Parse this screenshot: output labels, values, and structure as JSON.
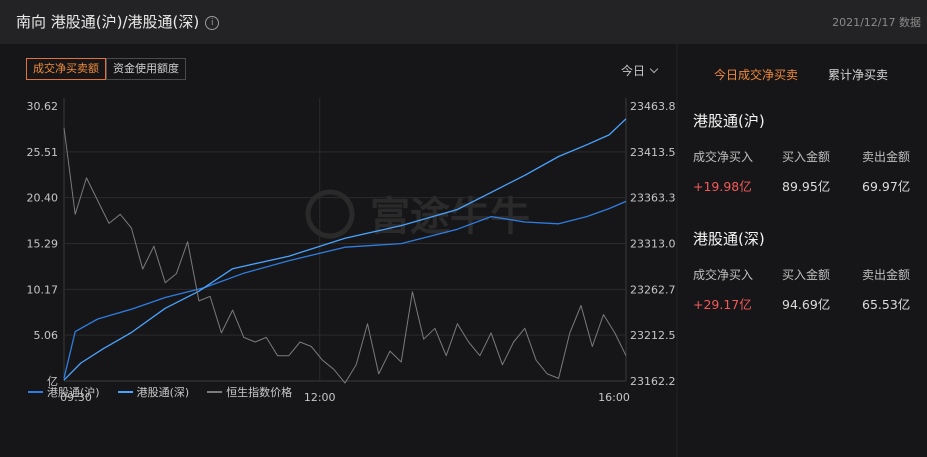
{
  "header": {
    "title": "南向 港股通(沪)/港股通(深)",
    "info_icon": "info-icon",
    "date": "2021/12/17 数据"
  },
  "chart_tabs": [
    {
      "label": "成交净买卖额",
      "active": true
    },
    {
      "label": "资金使用额度",
      "active": false
    }
  ],
  "period": {
    "label": "今日"
  },
  "right_tabs": [
    {
      "label": "今日成交净买卖",
      "active": true
    },
    {
      "label": "累计净买卖",
      "active": false
    }
  ],
  "panels": [
    {
      "title": "港股通(沪)",
      "labels": [
        "成交净买入",
        "买入金额",
        "卖出金额"
      ],
      "values": [
        "+19.98亿",
        "89.95亿",
        "69.97亿"
      ]
    },
    {
      "title": "港股通(深)",
      "labels": [
        "成交净买入",
        "买入金额",
        "卖出金额"
      ],
      "values": [
        "+29.17亿",
        "94.69亿",
        "65.53亿"
      ]
    }
  ],
  "watermark": "富途牛牛",
  "colors": {
    "accent": "#f08a3c",
    "positive": "#f25a5a",
    "series_sh": "#2f7de1",
    "series_sz": "#4aa3ff",
    "series_hsi": "#7a7a7a"
  },
  "chart_data": {
    "type": "line",
    "x_ticks": [
      "09:30",
      "12:00",
      "16:00"
    ],
    "y_left_ticks": [
      "30.62",
      "25.51",
      "20.40",
      "15.29",
      "10.17",
      "5.06",
      "亿"
    ],
    "y_left_range": [
      0,
      30.62
    ],
    "y_right_ticks": [
      "23463.8",
      "23413.5",
      "23363.3",
      "23313.0",
      "23262.7",
      "23212.5",
      "23162.2"
    ],
    "y_right_range": [
      23162.2,
      23463.8
    ],
    "grid": true,
    "legend_position": "bottom-left",
    "series": [
      {
        "name": "港股通(沪)",
        "axis": "left",
        "x": [
          0,
          0.02,
          0.06,
          0.12,
          0.18,
          0.25,
          0.32,
          0.4,
          0.5,
          0.6,
          0.7,
          0.76,
          0.82,
          0.88,
          0.93,
          0.97,
          1.0
        ],
        "values": [
          0.3,
          5.5,
          6.9,
          8.0,
          9.3,
          10.4,
          12.0,
          13.4,
          14.9,
          15.3,
          16.9,
          18.3,
          17.7,
          17.5,
          18.3,
          19.2,
          20.0
        ]
      },
      {
        "name": "港股通(深)",
        "axis": "left",
        "x": [
          0,
          0.03,
          0.07,
          0.12,
          0.18,
          0.24,
          0.3,
          0.4,
          0.5,
          0.6,
          0.7,
          0.76,
          0.82,
          0.88,
          0.93,
          0.97,
          1.0
        ],
        "values": [
          0.1,
          2.0,
          3.6,
          5.4,
          8.1,
          10.0,
          12.5,
          13.9,
          15.9,
          17.3,
          19.1,
          21.0,
          22.9,
          25.0,
          26.3,
          27.4,
          29.2
        ]
      },
      {
        "name": "恒生指数价格",
        "axis": "right",
        "x": [
          0,
          0.02,
          0.04,
          0.06,
          0.08,
          0.1,
          0.12,
          0.14,
          0.16,
          0.18,
          0.2,
          0.22,
          0.24,
          0.26,
          0.28,
          0.3,
          0.32,
          0.34,
          0.36,
          0.38,
          0.4,
          0.42,
          0.44,
          0.46,
          0.48,
          0.5,
          0.52,
          0.54,
          0.56,
          0.58,
          0.6,
          0.62,
          0.64,
          0.66,
          0.68,
          0.7,
          0.72,
          0.74,
          0.76,
          0.78,
          0.8,
          0.82,
          0.84,
          0.86,
          0.88,
          0.9,
          0.92,
          0.94,
          0.96,
          0.98,
          1.0
        ],
        "values": [
          23440,
          23345,
          23385,
          23360,
          23335,
          23345,
          23330,
          23285,
          23310,
          23270,
          23280,
          23315,
          23250,
          23255,
          23215,
          23240,
          23210,
          23205,
          23210,
          23190,
          23190,
          23205,
          23200,
          23185,
          23175,
          23160,
          23180,
          23225,
          23170,
          23195,
          23183,
          23260,
          23208,
          23220,
          23190,
          23225,
          23205,
          23190,
          23215,
          23180,
          23205,
          23220,
          23185,
          23170,
          23165,
          23215,
          23245,
          23200,
          23235,
          23215,
          23190
        ]
      }
    ]
  }
}
